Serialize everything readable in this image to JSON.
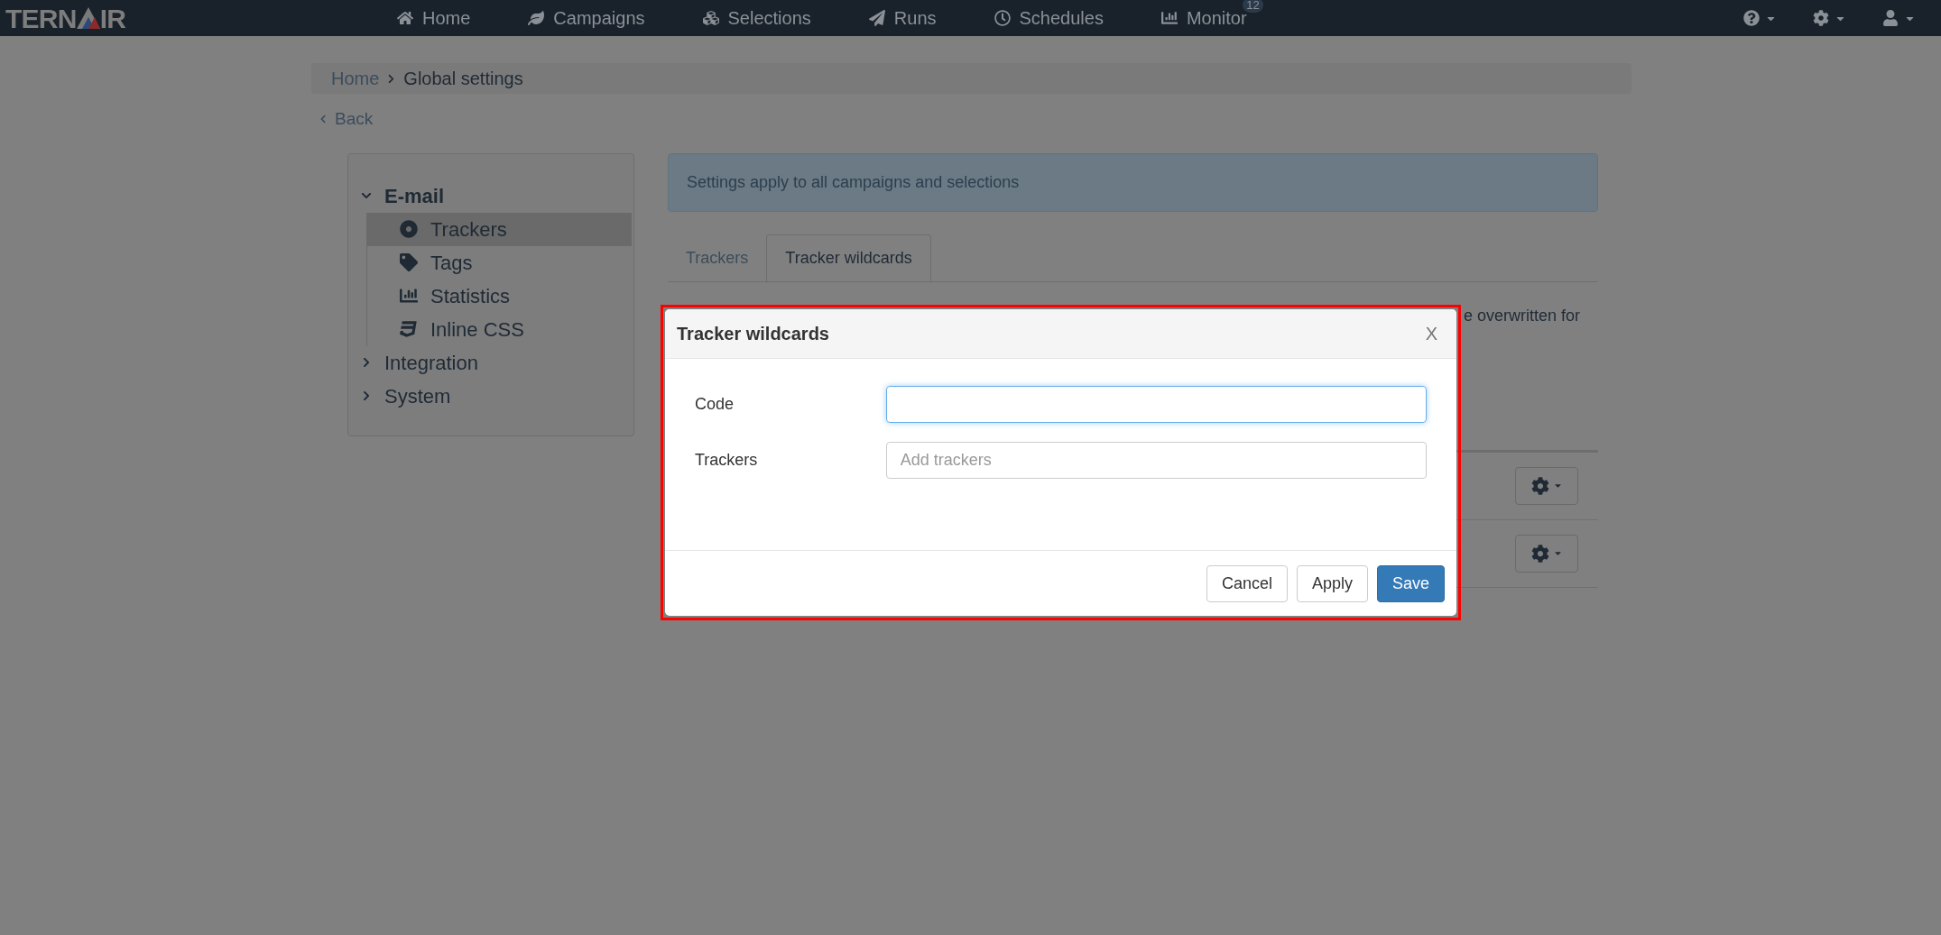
{
  "nav": {
    "logo": {
      "left": "TERN",
      "right": "IR"
    },
    "items": [
      {
        "label": "Home"
      },
      {
        "label": "Campaigns"
      },
      {
        "label": "Selections"
      },
      {
        "label": "Runs"
      },
      {
        "label": "Schedules"
      },
      {
        "label": "Monitor",
        "badge": "12"
      }
    ]
  },
  "breadcrumb": [
    "Home",
    "Global settings"
  ],
  "back": "Back",
  "sidebar": [
    {
      "label": "E-mail",
      "expanded": true,
      "children": [
        {
          "label": "Trackers",
          "selected": true
        },
        {
          "label": "Tags",
          "selected": false
        },
        {
          "label": "Statistics",
          "selected": false
        },
        {
          "label": "Inline CSS",
          "selected": false
        }
      ]
    },
    {
      "label": "Integration",
      "expanded": false
    },
    {
      "label": "System",
      "expanded": false
    }
  ],
  "alert": "Settings apply to all campaigns and selections",
  "tabs": [
    {
      "label": "Trackers",
      "selected": false
    },
    {
      "label": "Tracker wildcards",
      "selected": true
    }
  ],
  "description": "e overwritten for",
  "table": {
    "rows": [
      {
        "kind": "actions"
      },
      {
        "kind": "actions"
      }
    ]
  },
  "modal": {
    "title": "Tracker wildcards",
    "close": "X",
    "fields": [
      {
        "label": "Code",
        "focused": true
      },
      {
        "label": "Trackers",
        "placeholder": "Add trackers",
        "focused": false
      }
    ],
    "buttons": [
      {
        "label": "Cancel",
        "primary": false
      },
      {
        "label": "Apply",
        "primary": false
      },
      {
        "label": "Save",
        "primary": true
      }
    ]
  }
}
